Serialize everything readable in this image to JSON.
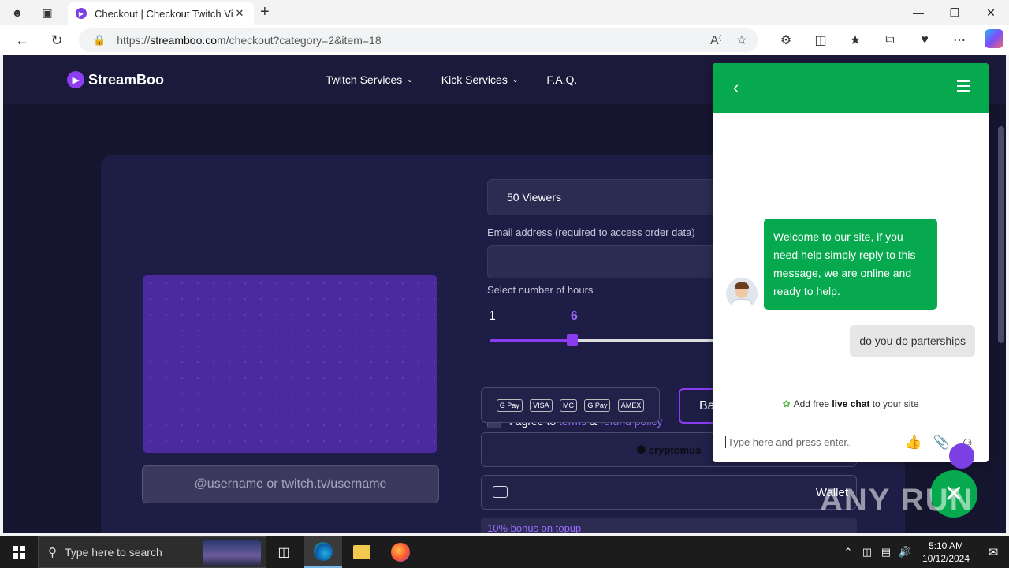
{
  "browser": {
    "tab_title": "Checkout | Checkout Twitch Viev",
    "url_prefix": "https://",
    "url_host": "streamboo.com",
    "url_path": "/checkout?category=2&item=18"
  },
  "site": {
    "brand": "StreamBoo",
    "nav": [
      "Twitch Services",
      "Kick Services",
      "F.A.Q."
    ],
    "username_placeholder": "@username or twitch.tv/username",
    "package_selected": "50 Viewers",
    "email_label": "Email address (required to access order data)",
    "hours_label": "Select number of hours",
    "hours_min": "1",
    "hours_selected": "6",
    "hours_fraction": 0.35,
    "agree_prefix": "I agree to",
    "agree_terms": "terms",
    "agree_and": "&",
    "agree_refund": "refund policy",
    "payment_icons": [
      "G Pay",
      "VISA",
      "MC",
      "G Pay",
      "AMEX"
    ],
    "balance_button": "Ba",
    "crypto_label": "cryptomus",
    "wallet_label": "Wallet",
    "bonus_text": "10% bonus on topup"
  },
  "chat": {
    "welcome": "Welcome to our site, if you need help simply reply to this message, we are online and ready to help.",
    "user_message": "do you do parterships",
    "promo_prefix": "Add free",
    "promo_bold": "live chat",
    "promo_suffix": "to your site",
    "input_placeholder": "Type here and press enter.."
  },
  "watermark": "ANY RUN",
  "taskbar": {
    "search_placeholder": "Type here to search",
    "time": "5:10 AM",
    "date": "10/12/2024"
  },
  "colors": {
    "accent": "#8a3cf0",
    "chat_green": "#06a94d",
    "page_bg": "#161530"
  }
}
